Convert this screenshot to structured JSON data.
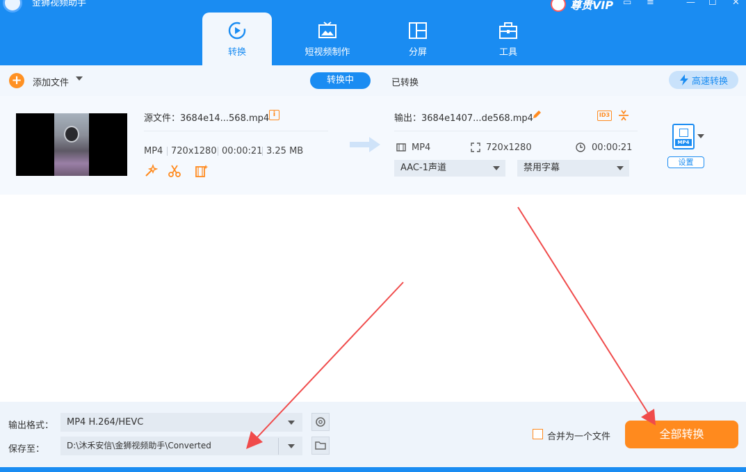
{
  "app": {
    "title": "金狮视频助手",
    "vip_label": "尊贵VIP",
    "window_controls": [
      "—",
      "☐",
      "✕"
    ]
  },
  "colors": {
    "brand_blue": "#1a8cf2",
    "accent_orange": "#ff8a1e",
    "annotation_red": "#f04b4b"
  },
  "tabs": [
    {
      "label": "转换",
      "icon": "convert-icon",
      "active": true
    },
    {
      "label": "短视频制作",
      "icon": "short-video-icon",
      "active": false
    },
    {
      "label": "分屏",
      "icon": "split-screen-icon",
      "active": false
    },
    {
      "label": "工具",
      "icon": "toolbox-icon",
      "active": false
    }
  ],
  "toolbar": {
    "add_file_label": "添加文件",
    "add_icon": "+",
    "converting_label": "转换中",
    "converted_label": "已转换",
    "fast_convert_label": "高速转换"
  },
  "file": {
    "source_label": "源文件：3684e14...568.mp4",
    "source_format": "MP4",
    "source_resolution": "720x1280",
    "source_duration": "00:00:21",
    "source_size": "3.25 MB",
    "output_label": "输出：3684e1407...de568.mp4",
    "output_format": "MP4",
    "output_resolution": "720x1280",
    "output_duration": "00:00:21",
    "audio_track": "AAC-1声道",
    "subtitle": "禁用字幕",
    "format_tag": "MP4",
    "id3_tag": "ID3",
    "settings_label": "设置"
  },
  "footer": {
    "output_format_label": "输出格式：",
    "output_format_value": "MP4 H.264/HEVC",
    "save_to_label": "保存至：",
    "save_to_value": "D:\\沐禾安信\\金狮视频助手\\Converted",
    "merge_label": "合并为一个文件",
    "merge_checked": false,
    "convert_all_label": "全部转换"
  }
}
